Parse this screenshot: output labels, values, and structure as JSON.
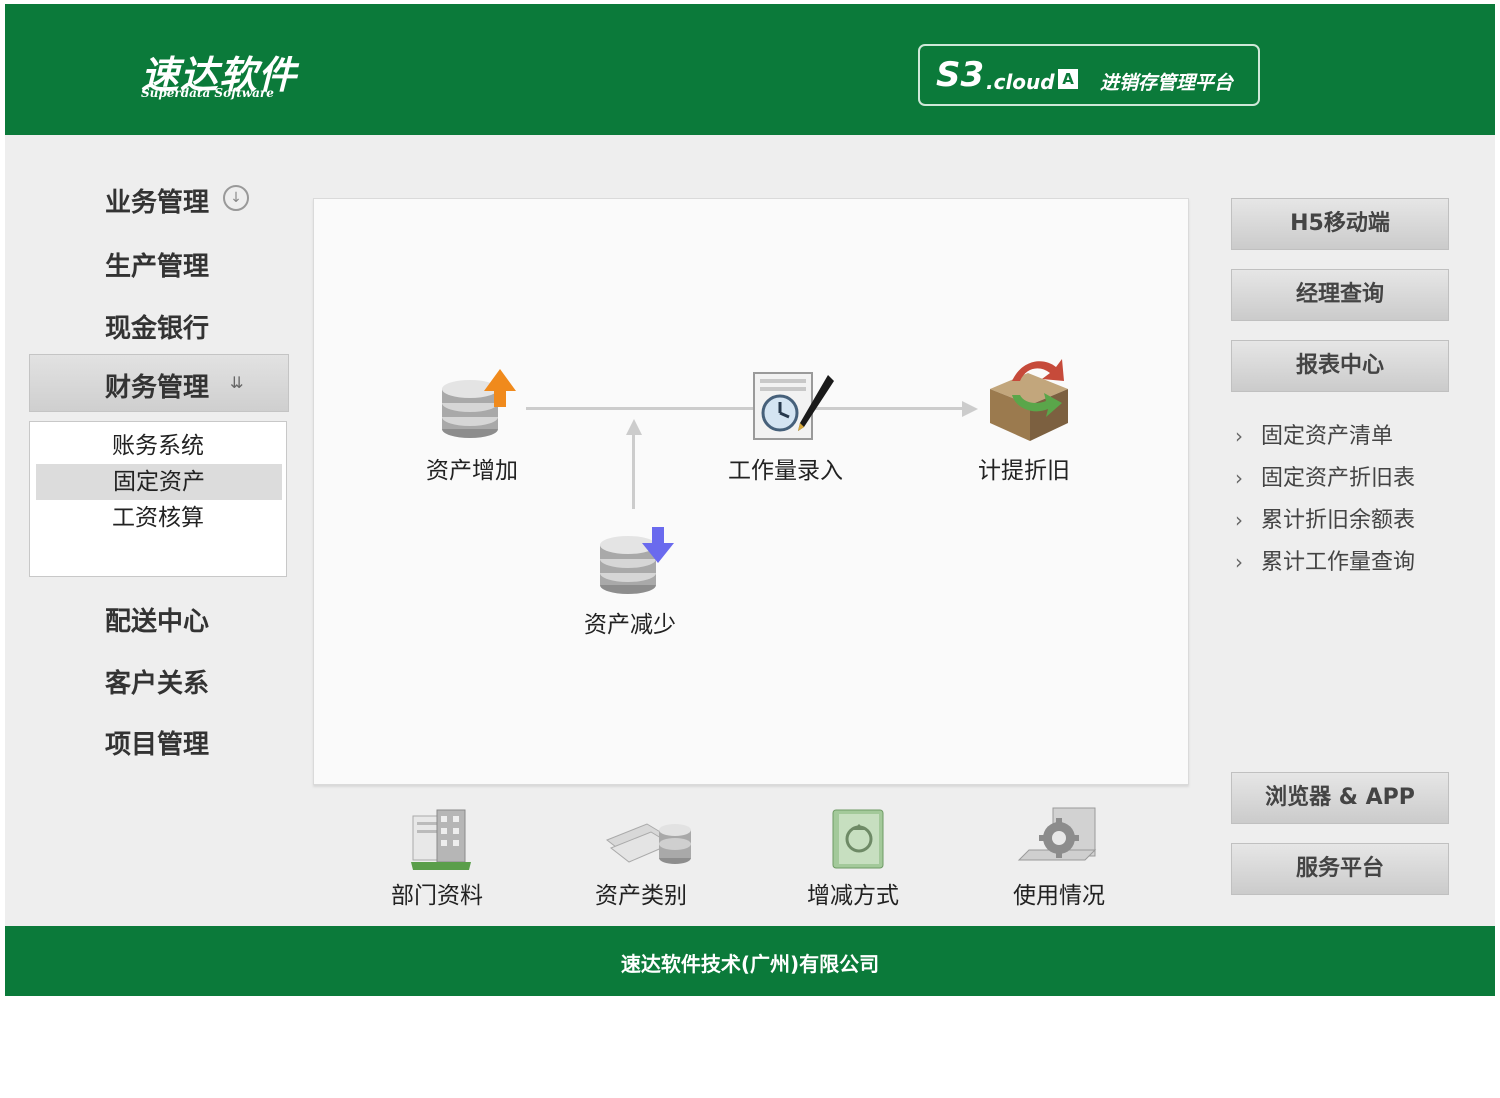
{
  "header": {
    "logo_cn": "速达软件",
    "logo_en": "Superdata Software",
    "brand_s3": "S3",
    "brand_cloud": ".cloud",
    "brand_badge": "A",
    "brand_subtitle": "进销存管理平台"
  },
  "nav": {
    "items": [
      "业务管理",
      "生产管理",
      "现金银行",
      "财务管理",
      "配送中心",
      "客户关系",
      "项目管理"
    ],
    "active": "财务管理",
    "submenu": [
      "账务系统",
      "固定资产",
      "工资核算"
    ],
    "submenu_selected": "固定资产"
  },
  "workflow": {
    "asset_add": "资产增加",
    "asset_reduce": "资产减少",
    "workload_entry": "工作量录入",
    "depreciation": "计提折旧"
  },
  "shortcuts": [
    "部门资料",
    "资产类别",
    "增减方式",
    "使用情况"
  ],
  "right": {
    "buttons_top": [
      "H5移动端",
      "经理查询",
      "报表中心"
    ],
    "links": [
      "固定资产清单",
      "固定资产折旧表",
      "累计折旧余额表",
      "累计工作量查询"
    ],
    "buttons_bottom": [
      "浏览器 & APP",
      "服务平台"
    ]
  },
  "footer": {
    "company": "速达软件技术(广州)有限公司"
  },
  "colors": {
    "brand_green": "#0b7a3a",
    "background": "#eeeeee",
    "panel": "#fafafa"
  }
}
